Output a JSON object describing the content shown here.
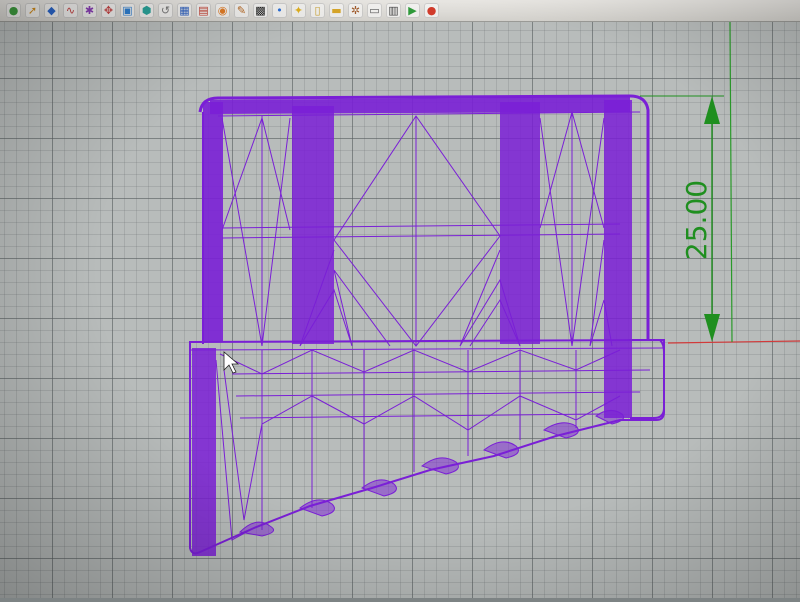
{
  "toolbar": {
    "icons": [
      {
        "name": "sphere-icon",
        "color": "#3f9c3f",
        "glyph": "●"
      },
      {
        "name": "arrow-icon",
        "color": "#d08a1a",
        "glyph": "➚"
      },
      {
        "name": "layers-icon",
        "color": "#2a65c9",
        "glyph": "◆"
      },
      {
        "name": "curve-icon",
        "color": "#c23b3b",
        "glyph": "∿"
      },
      {
        "name": "shape-icon",
        "color": "#8a3fb6",
        "glyph": "✱"
      },
      {
        "name": "move-icon",
        "color": "#c74848",
        "glyph": "✥"
      },
      {
        "name": "box-icon",
        "color": "#2f7fd1",
        "glyph": "▣"
      },
      {
        "name": "cube-icon",
        "color": "#2aa39a",
        "glyph": "⬢"
      },
      {
        "name": "pipe-icon",
        "color": "#7a7a7a",
        "glyph": "↺"
      },
      {
        "name": "mesh-icon",
        "color": "#2c5fbf",
        "glyph": "▦"
      },
      {
        "name": "save-icon",
        "color": "#c0392b",
        "glyph": "▤"
      },
      {
        "name": "render-icon",
        "color": "#e07b25",
        "glyph": "◉"
      },
      {
        "name": "pencil-icon",
        "color": "#b5651d",
        "glyph": "✎"
      },
      {
        "name": "checker-icon",
        "color": "#222222",
        "glyph": "▩"
      },
      {
        "name": "dot-icon",
        "color": "#2b6fd8",
        "glyph": "•"
      },
      {
        "name": "light-icon",
        "color": "#e0b020",
        "glyph": "✦"
      },
      {
        "name": "lock-icon",
        "color": "#c8a030",
        "glyph": "▯"
      },
      {
        "name": "folder-icon",
        "color": "#d8a628",
        "glyph": "▬"
      },
      {
        "name": "gear-icon",
        "color": "#a05a2a",
        "glyph": "✲"
      },
      {
        "name": "window-icon",
        "color": "#555555",
        "glyph": "▭"
      },
      {
        "name": "grid-icon",
        "color": "#444444",
        "glyph": "▥"
      },
      {
        "name": "play-icon",
        "color": "#2f9a3a",
        "glyph": "▶"
      },
      {
        "name": "record-icon",
        "color": "#d13b2b",
        "glyph": "●"
      }
    ]
  },
  "viewport": {
    "dimension_label": "25.00",
    "dimension_color": "#1f8f1f",
    "wire_color": "#7a1fd6",
    "axis_x_color": "#d23a3a",
    "axis_y_color": "#2a9a2a"
  }
}
